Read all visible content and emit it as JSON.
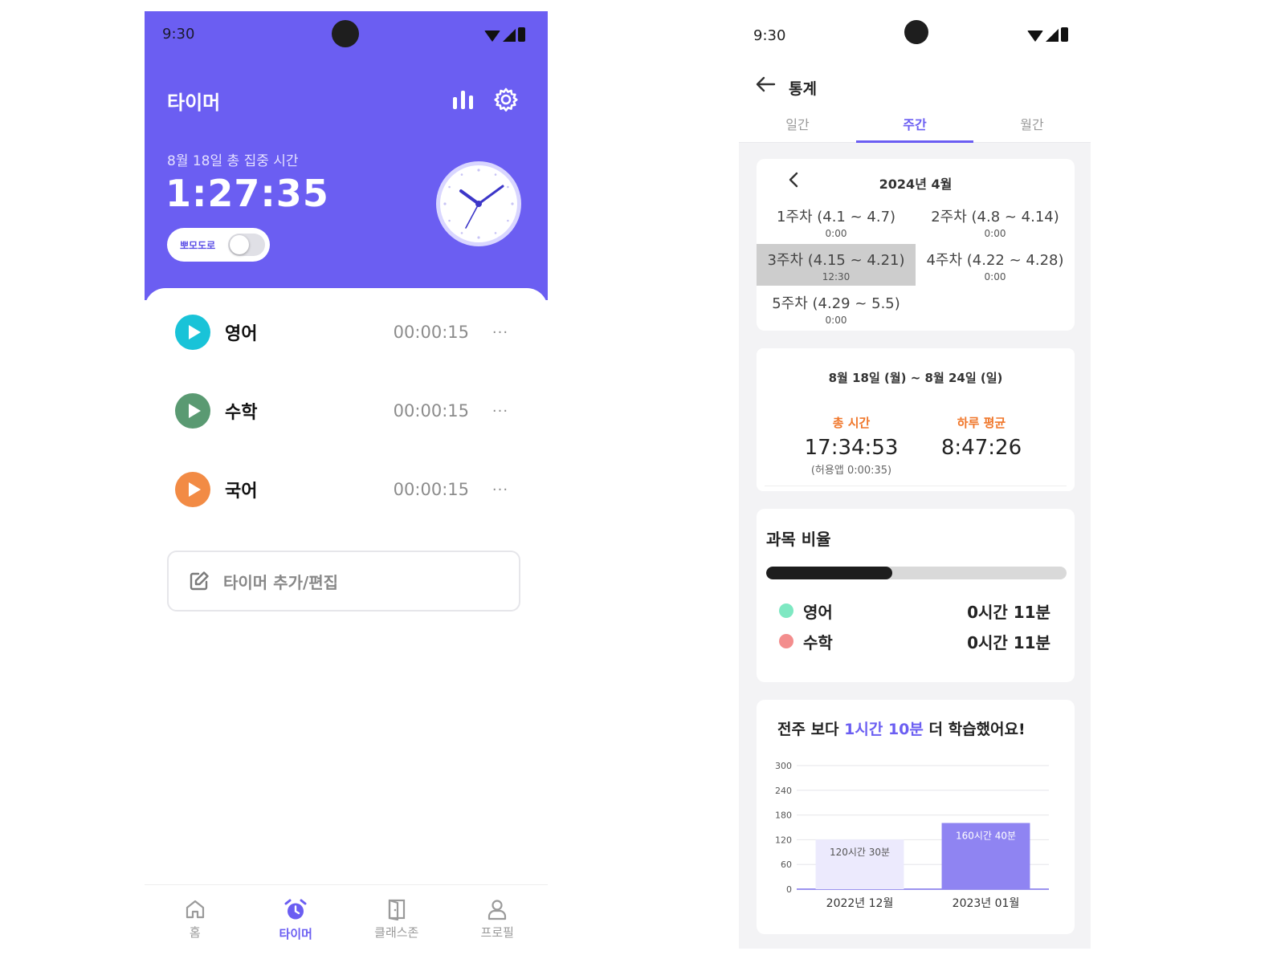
{
  "timer_screen": {
    "status_time": "9:30",
    "title": "타이머",
    "date_label": "8월 18일 총 집중 시간",
    "total_time": "1:27:35",
    "pomodoro_label": "뽀모도로",
    "pomodoro_on": false,
    "timers": [
      {
        "name": "영어",
        "elapsed": "00:00:15",
        "color": "#19c3d8"
      },
      {
        "name": "수학",
        "elapsed": "00:00:15",
        "color": "#5a9a72"
      },
      {
        "name": "국어",
        "elapsed": "00:00:15",
        "color": "#f28b45"
      }
    ],
    "more_label": "···",
    "add_label": "타이머 추가/편집",
    "nav": [
      {
        "label": "홈",
        "icon": "home-icon"
      },
      {
        "label": "타이머",
        "icon": "alarm-icon"
      },
      {
        "label": "클래스존",
        "icon": "door-icon"
      },
      {
        "label": "프로필",
        "icon": "person-icon"
      }
    ],
    "accent_color": "#6b5ef2"
  },
  "stats_screen": {
    "status_time": "9:30",
    "title": "통계",
    "tabs": [
      "일간",
      "주간",
      "월간"
    ],
    "active_tab": 1,
    "month_title": "2024년 4월",
    "weeks": [
      {
        "range": "1주차 (4.1 ~ 4.7)",
        "hours": "0:00"
      },
      {
        "range": "2주차 (4.8 ~ 4.14)",
        "hours": "0:00"
      },
      {
        "range": "3주차 (4.15 ~ 4.21)",
        "hours": "12:30"
      },
      {
        "range": "4주차 (4.22 ~ 4.28)",
        "hours": "0:00"
      },
      {
        "range": "5주차 (4.29 ~ 5.5)",
        "hours": "0:00"
      }
    ],
    "selected_week": 2,
    "date_range": "8월 18일 (월) ~ 8월 24일 (일)",
    "total_label": "총 시간",
    "total_value": "17:34:53",
    "total_sub": "(허용앱 0:00:35)",
    "avg_label": "하루 평균",
    "avg_value": "8:47:26",
    "ratio_title": "과목 비율",
    "ratio_fill_fraction": 0.42,
    "subjects": [
      {
        "name": "영어",
        "time": "0시간 11분",
        "color": "#7ee8c2"
      },
      {
        "name": "수학",
        "time": "0시간 11분",
        "color": "#f38d8d"
      }
    ],
    "compare": {
      "prefix": "전주 보다 ",
      "highlight": "1시간 10분",
      "suffix": " 더 학습했어요!"
    }
  },
  "chart_data": {
    "type": "bar",
    "categories": [
      "2022년 12월",
      "2023년 01월"
    ],
    "values": [
      120.5,
      160.67
    ],
    "data_labels": [
      "120시간 30분",
      "160시간 40분"
    ],
    "y_ticks": [
      "0",
      "60",
      "120",
      "180",
      "240",
      "300"
    ],
    "ylim": [
      0,
      300
    ],
    "grid": true,
    "bar_colors": [
      "#eceafd",
      "#8f84f2"
    ],
    "label_colors": [
      "#555555",
      "#ffffff"
    ]
  }
}
